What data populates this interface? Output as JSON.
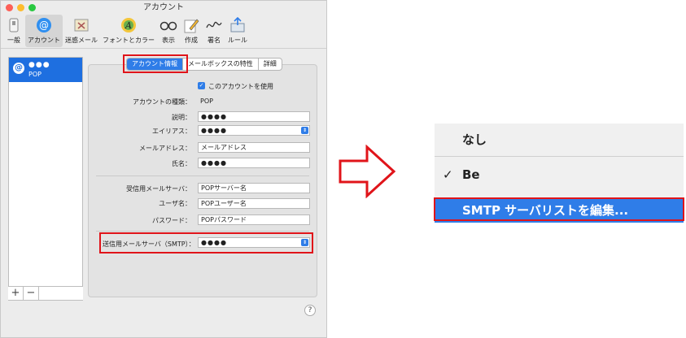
{
  "window": {
    "title": "アカウント"
  },
  "toolbar": [
    {
      "label": "一般",
      "icon": "switch-icon"
    },
    {
      "label": "アカウント",
      "icon": "at-icon"
    },
    {
      "label": "迷惑メール",
      "icon": "junk-mail-icon"
    },
    {
      "label": "フォントとカラー",
      "icon": "font-color-icon"
    },
    {
      "label": "表示",
      "icon": "glasses-icon"
    },
    {
      "label": "作成",
      "icon": "pencil-icon"
    },
    {
      "label": "署名",
      "icon": "signature-icon"
    },
    {
      "label": "ルール",
      "icon": "rules-icon"
    }
  ],
  "sidebar": {
    "account": {
      "name": "●●●",
      "type": "POP",
      "icon": "at-icon"
    },
    "add_label": "+",
    "remove_label": "−"
  },
  "tabs": [
    {
      "label": "アカウント情報",
      "selected": true
    },
    {
      "label": "メールボックスの特性",
      "selected": false
    },
    {
      "label": "詳細",
      "selected": false
    }
  ],
  "form": {
    "enable_label": "このアカウントを使用",
    "account_type_label": "アカウントの種類：",
    "account_type_value": "POP",
    "description_label": "説明：",
    "description_value": "●●●●",
    "alias_label": "エイリアス：",
    "alias_value": "●●●●",
    "email_label": "メールアドレス：",
    "email_value": "メールアドレス",
    "name_label": "氏名：",
    "name_value": "●●●●",
    "incoming_server_label": "受信用メールサーバ：",
    "incoming_server_value": "POPサーバー名",
    "username_label": "ユーザ名：",
    "username_value": "POPユーザー名",
    "password_label": "パスワード：",
    "password_value": "POPパスワード",
    "smtp_label": "送信用メールサーバ（SMTP）：",
    "smtp_value": "●●●●"
  },
  "help_label": "?",
  "menu": {
    "items": [
      {
        "label": "なし",
        "checked": false,
        "highlighted": false
      },
      {
        "label": "Be",
        "checked": true,
        "highlighted": false
      },
      {
        "label": "SMTP サーバリストを編集...",
        "checked": false,
        "highlighted": true
      }
    ],
    "check_mark": "✓"
  },
  "colors": {
    "accent": "#2f7de8",
    "highlight_box": "#e0141a"
  }
}
